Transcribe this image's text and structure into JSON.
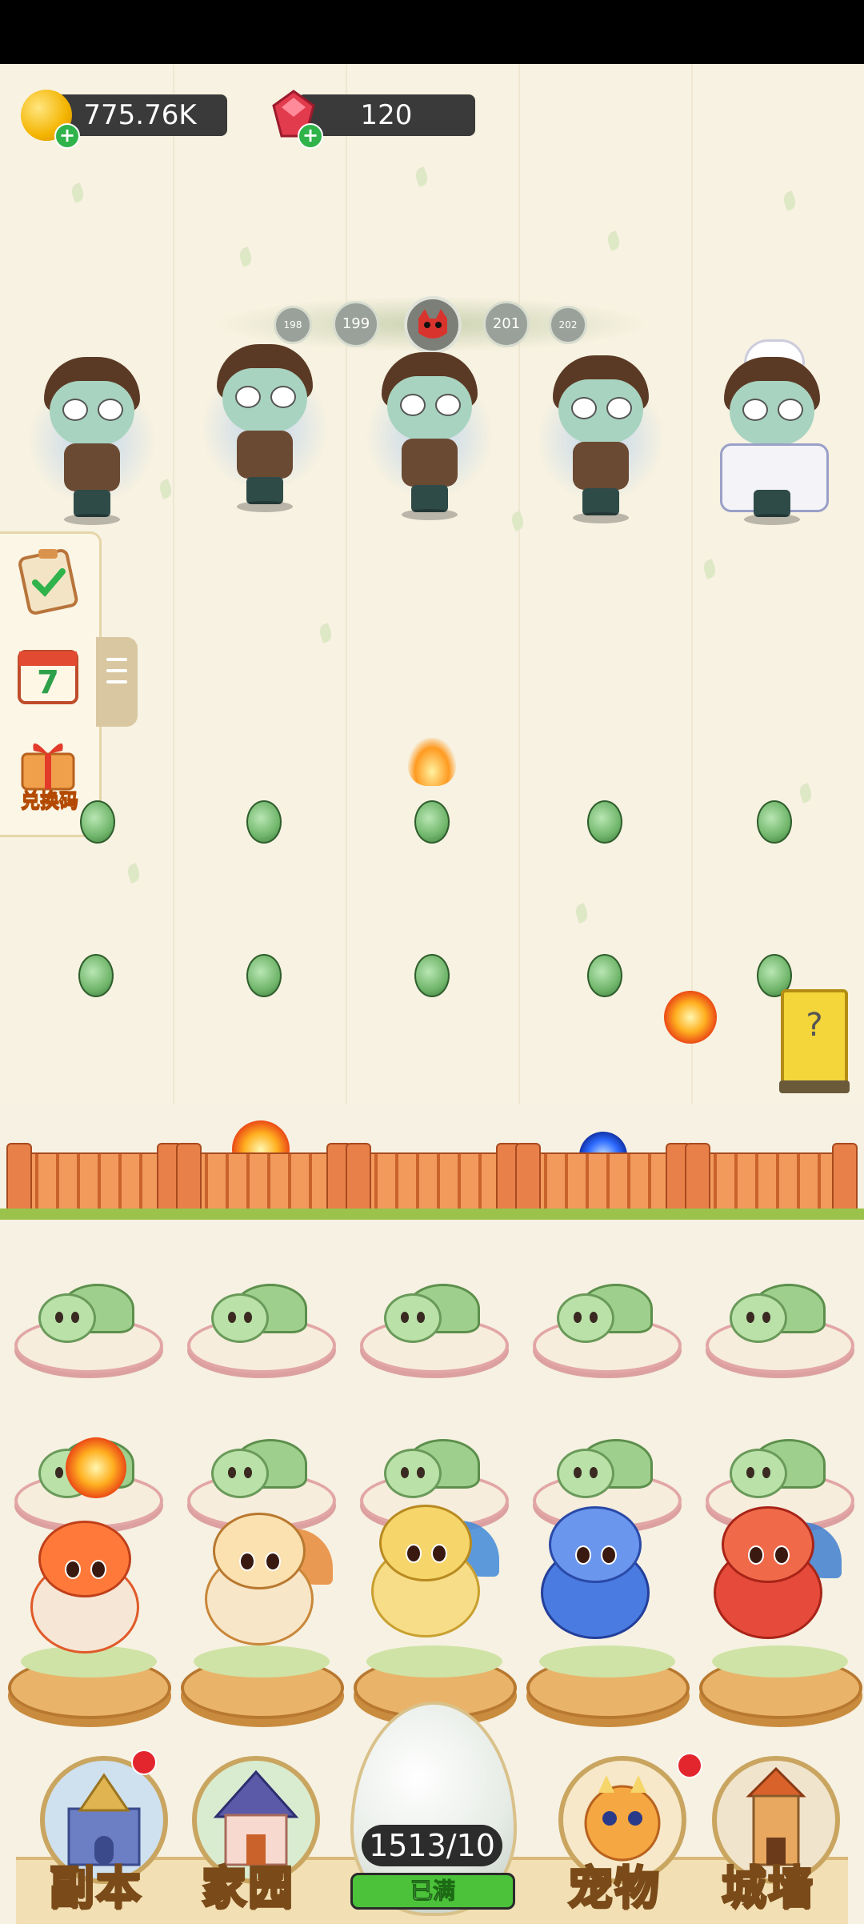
{
  "currency": {
    "gold": "775.76K",
    "gems": "120"
  },
  "wave": {
    "prev2": "198",
    "prev1": "199",
    "next1": "201",
    "next2": "202"
  },
  "side_menu": {
    "redeem_label": "兑换码",
    "calendar_day": "7"
  },
  "mystery_card": {
    "symbol": "?"
  },
  "egg": {
    "count": "1513/10",
    "status": "已满"
  },
  "nav": {
    "dungeon": "副本",
    "home": "家园",
    "pets": "宠物",
    "wall": "城墙"
  },
  "colors": {
    "background": "#f7f2e1",
    "currency_bar": "#3a3a3a",
    "egg_status_green": "#4bc23a",
    "notification_red": "#e3262e"
  }
}
